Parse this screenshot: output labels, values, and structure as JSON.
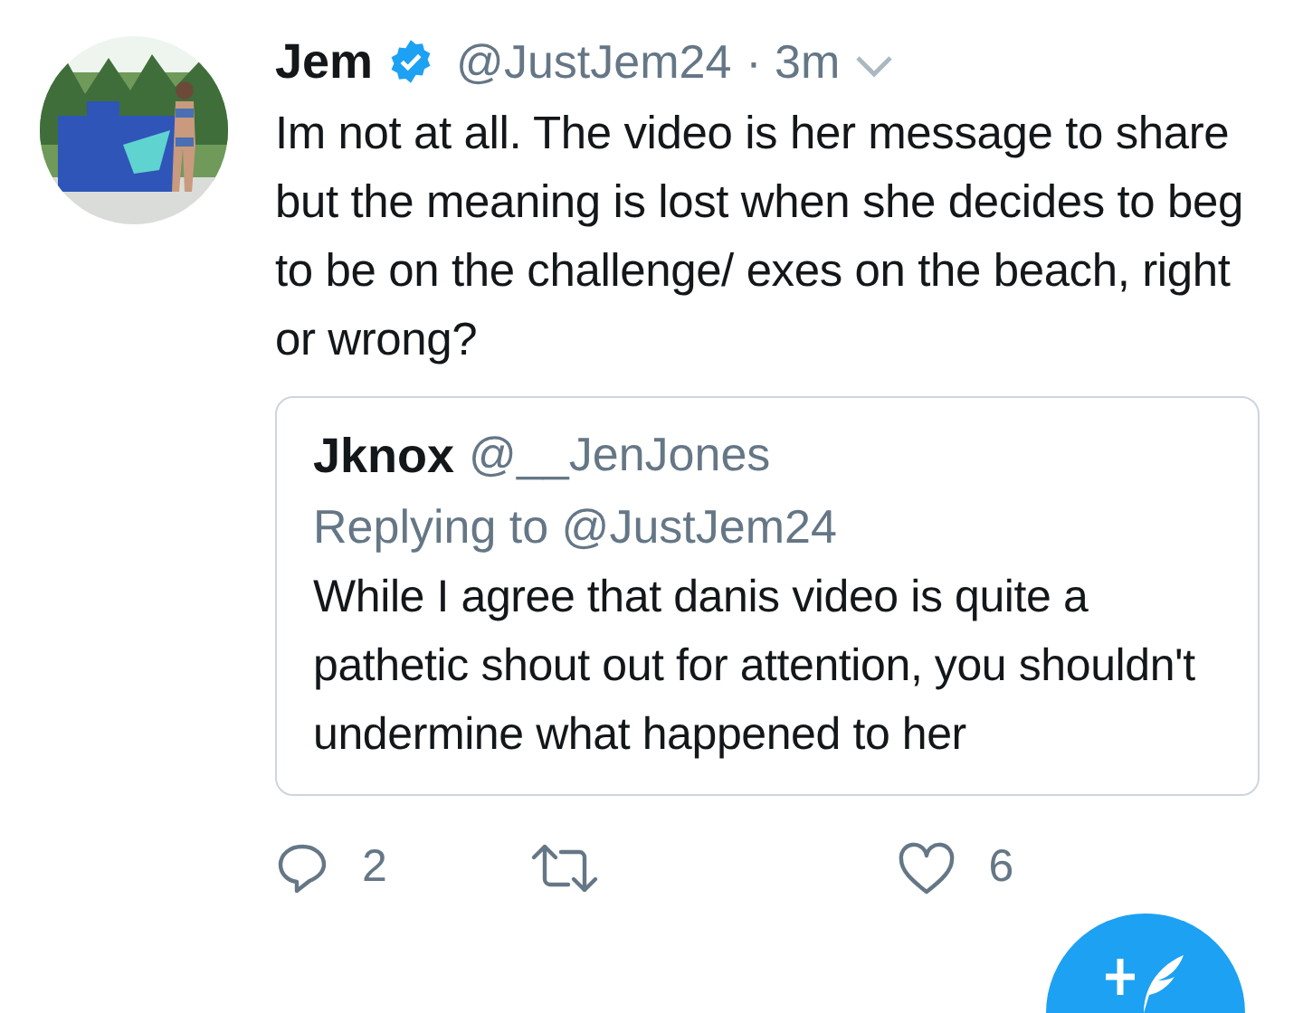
{
  "tweet": {
    "name": "Jem",
    "verified": true,
    "handle": "@JustJem24",
    "time": "· 3m",
    "text": "Im not at all. The video is her message to share but the meaning is lost when she decides to beg to be on the challenge/ exes on the beach, right or wrong?",
    "quoted": {
      "name": "Jknox",
      "handle": "@__JenJones",
      "replying": "Replying to @JustJem24",
      "text": "While I agree that danis video is quite a pathetic shout out for attention, you shouldn't undermine what happened to her"
    },
    "actions": [
      {
        "kind": "reply",
        "count": "2"
      },
      {
        "kind": "retweet"
      },
      {
        "kind": "like",
        "count": "6"
      }
    ]
  }
}
